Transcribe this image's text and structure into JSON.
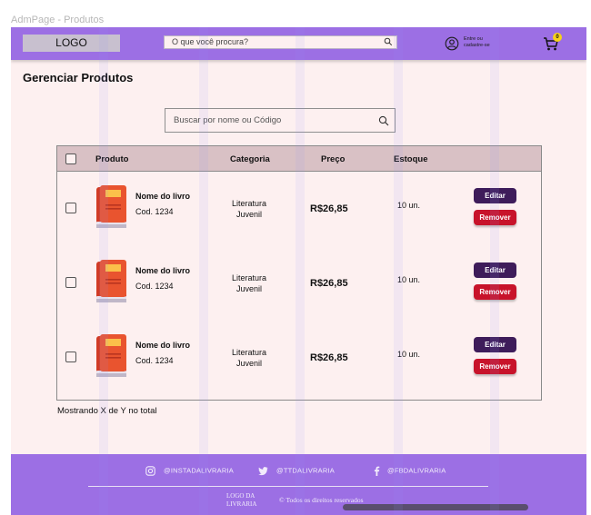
{
  "frame_label": "AdmPage - Produtos",
  "header": {
    "logo": "LOGO",
    "search_placeholder": "O que você procura?",
    "user_text": "Entre ou cadastre-se",
    "cart_count": "0"
  },
  "page_title": "Gerenciar Produtos",
  "search": {
    "placeholder": "Buscar por nome ou Código"
  },
  "table": {
    "columns": [
      "Produto",
      "Categoria",
      "Preço",
      "Estoque"
    ],
    "rows": [
      {
        "name": "Nome do livro",
        "code": "Cod. 1234",
        "category_line1": "Literatura",
        "category_line2": "Juvenil",
        "price": "R$26,85",
        "stock": "10 un.",
        "edit": "Editar",
        "remove": "Remover"
      },
      {
        "name": "Nome do livro",
        "code": "Cod. 1234",
        "category_line1": "Literatura",
        "category_line2": "Juvenil",
        "price": "R$26,85",
        "stock": "10 un.",
        "edit": "Editar",
        "remove": "Remover"
      },
      {
        "name": "Nome do livro",
        "code": "Cod. 1234",
        "category_line1": "Literatura",
        "category_line2": "Juvenil",
        "price": "R$26,85",
        "stock": "10 un.",
        "edit": "Editar",
        "remove": "Remover"
      }
    ]
  },
  "showing_text": "Mostrando X de Y no total",
  "footer": {
    "instagram": "@INSTADALIVRARIA",
    "twitter": "@TTDALIVRARIA",
    "facebook": "@FBDALIVRARIA",
    "logo_line1": "LOGO DA",
    "logo_line2": "LIVRARIA",
    "copyright": "© Todos os direitos reservados"
  },
  "colors": {
    "header_bg": "#9c6fe4",
    "page_bg": "#fdf0f0",
    "table_header_bg": "#d9c1c5",
    "edit_button": "#3e1c5a",
    "remove_button": "#c8132a",
    "badge": "#f7d21a"
  },
  "icons": [
    "search-icon",
    "user-icon",
    "cart-icon",
    "book-icon",
    "instagram-icon",
    "twitter-icon",
    "facebook-icon"
  ]
}
